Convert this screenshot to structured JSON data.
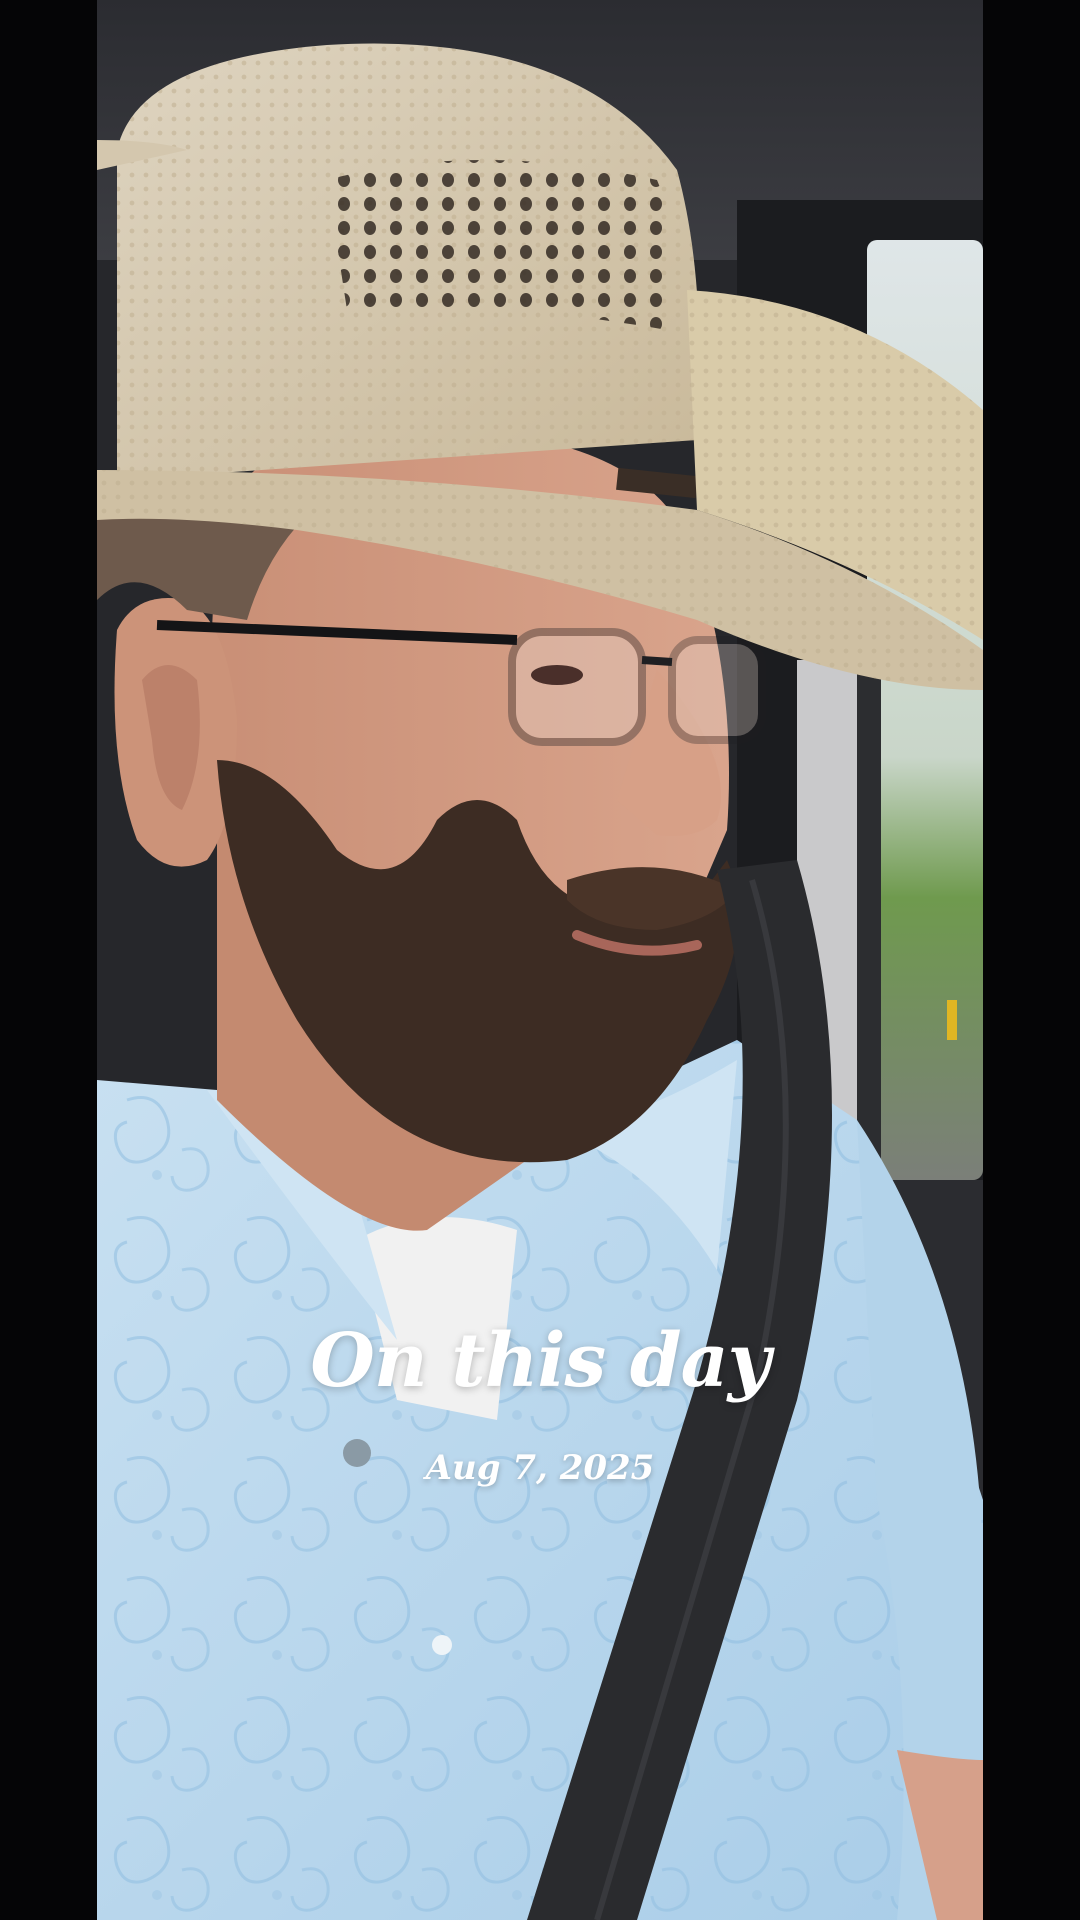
{
  "memory": {
    "title": "On this day",
    "date": "Aug 7, 2025"
  },
  "photo": {
    "subject": "photo-of-man-in-straw-cowboy-hat-driving"
  },
  "colors": {
    "letterbox": "#050506",
    "overlay_text": "#ffffff",
    "shirt": "#b9d8ee",
    "hat": "#d8ccb5",
    "beard": "#3a2a22",
    "seatbelt": "#2a2b2e"
  }
}
